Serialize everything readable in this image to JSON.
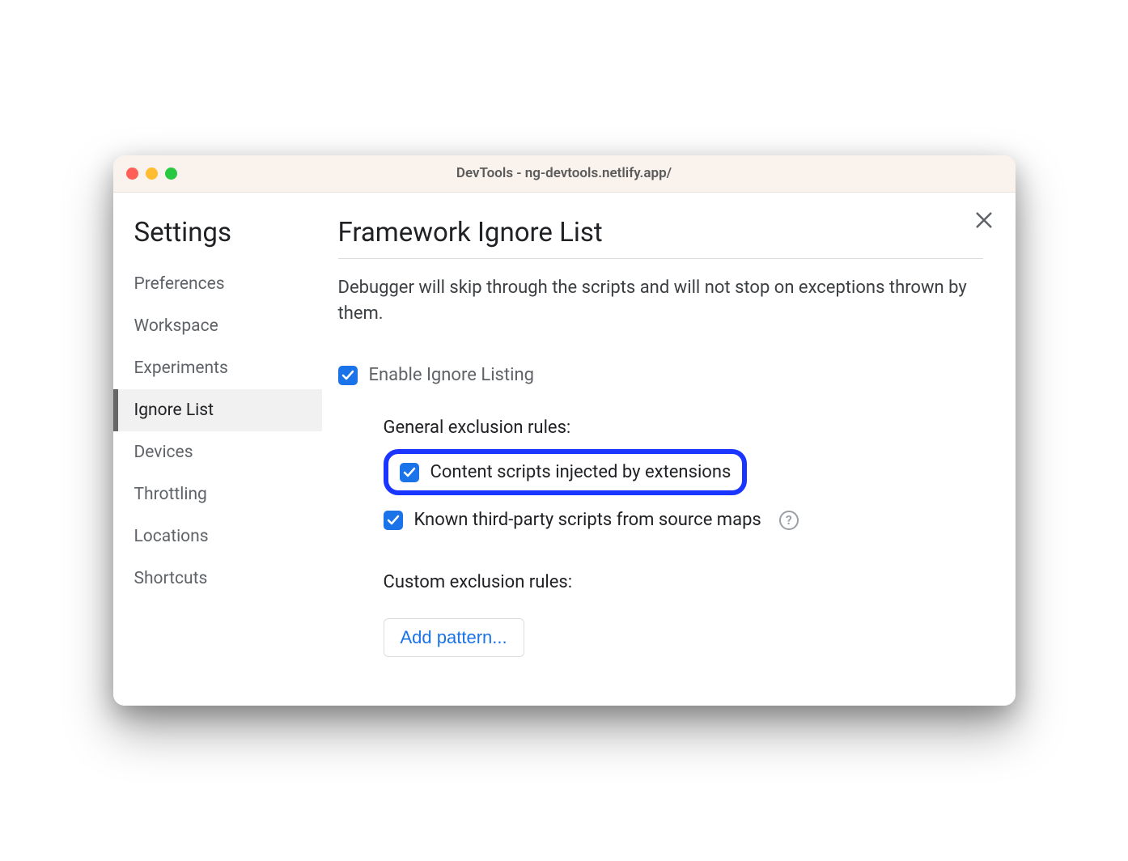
{
  "window": {
    "title": "DevTools - ng-devtools.netlify.app/"
  },
  "sidebar": {
    "title": "Settings",
    "items": [
      {
        "label": "Preferences",
        "active": false
      },
      {
        "label": "Workspace",
        "active": false
      },
      {
        "label": "Experiments",
        "active": false
      },
      {
        "label": "Ignore List",
        "active": true
      },
      {
        "label": "Devices",
        "active": false
      },
      {
        "label": "Throttling",
        "active": false
      },
      {
        "label": "Locations",
        "active": false
      },
      {
        "label": "Shortcuts",
        "active": false
      }
    ]
  },
  "page": {
    "title": "Framework Ignore List",
    "description": "Debugger will skip through the scripts and will not stop on exceptions thrown by them.",
    "enable_label": "Enable Ignore Listing",
    "enable_checked": true,
    "general_rules_title": "General exclusion rules:",
    "rules": [
      {
        "label": "Content scripts injected by extensions",
        "checked": true,
        "highlighted": true,
        "help": false
      },
      {
        "label": "Known third-party scripts from source maps",
        "checked": true,
        "highlighted": false,
        "help": true
      }
    ],
    "custom_rules_title": "Custom exclusion rules:",
    "add_pattern_label": "Add pattern..."
  }
}
